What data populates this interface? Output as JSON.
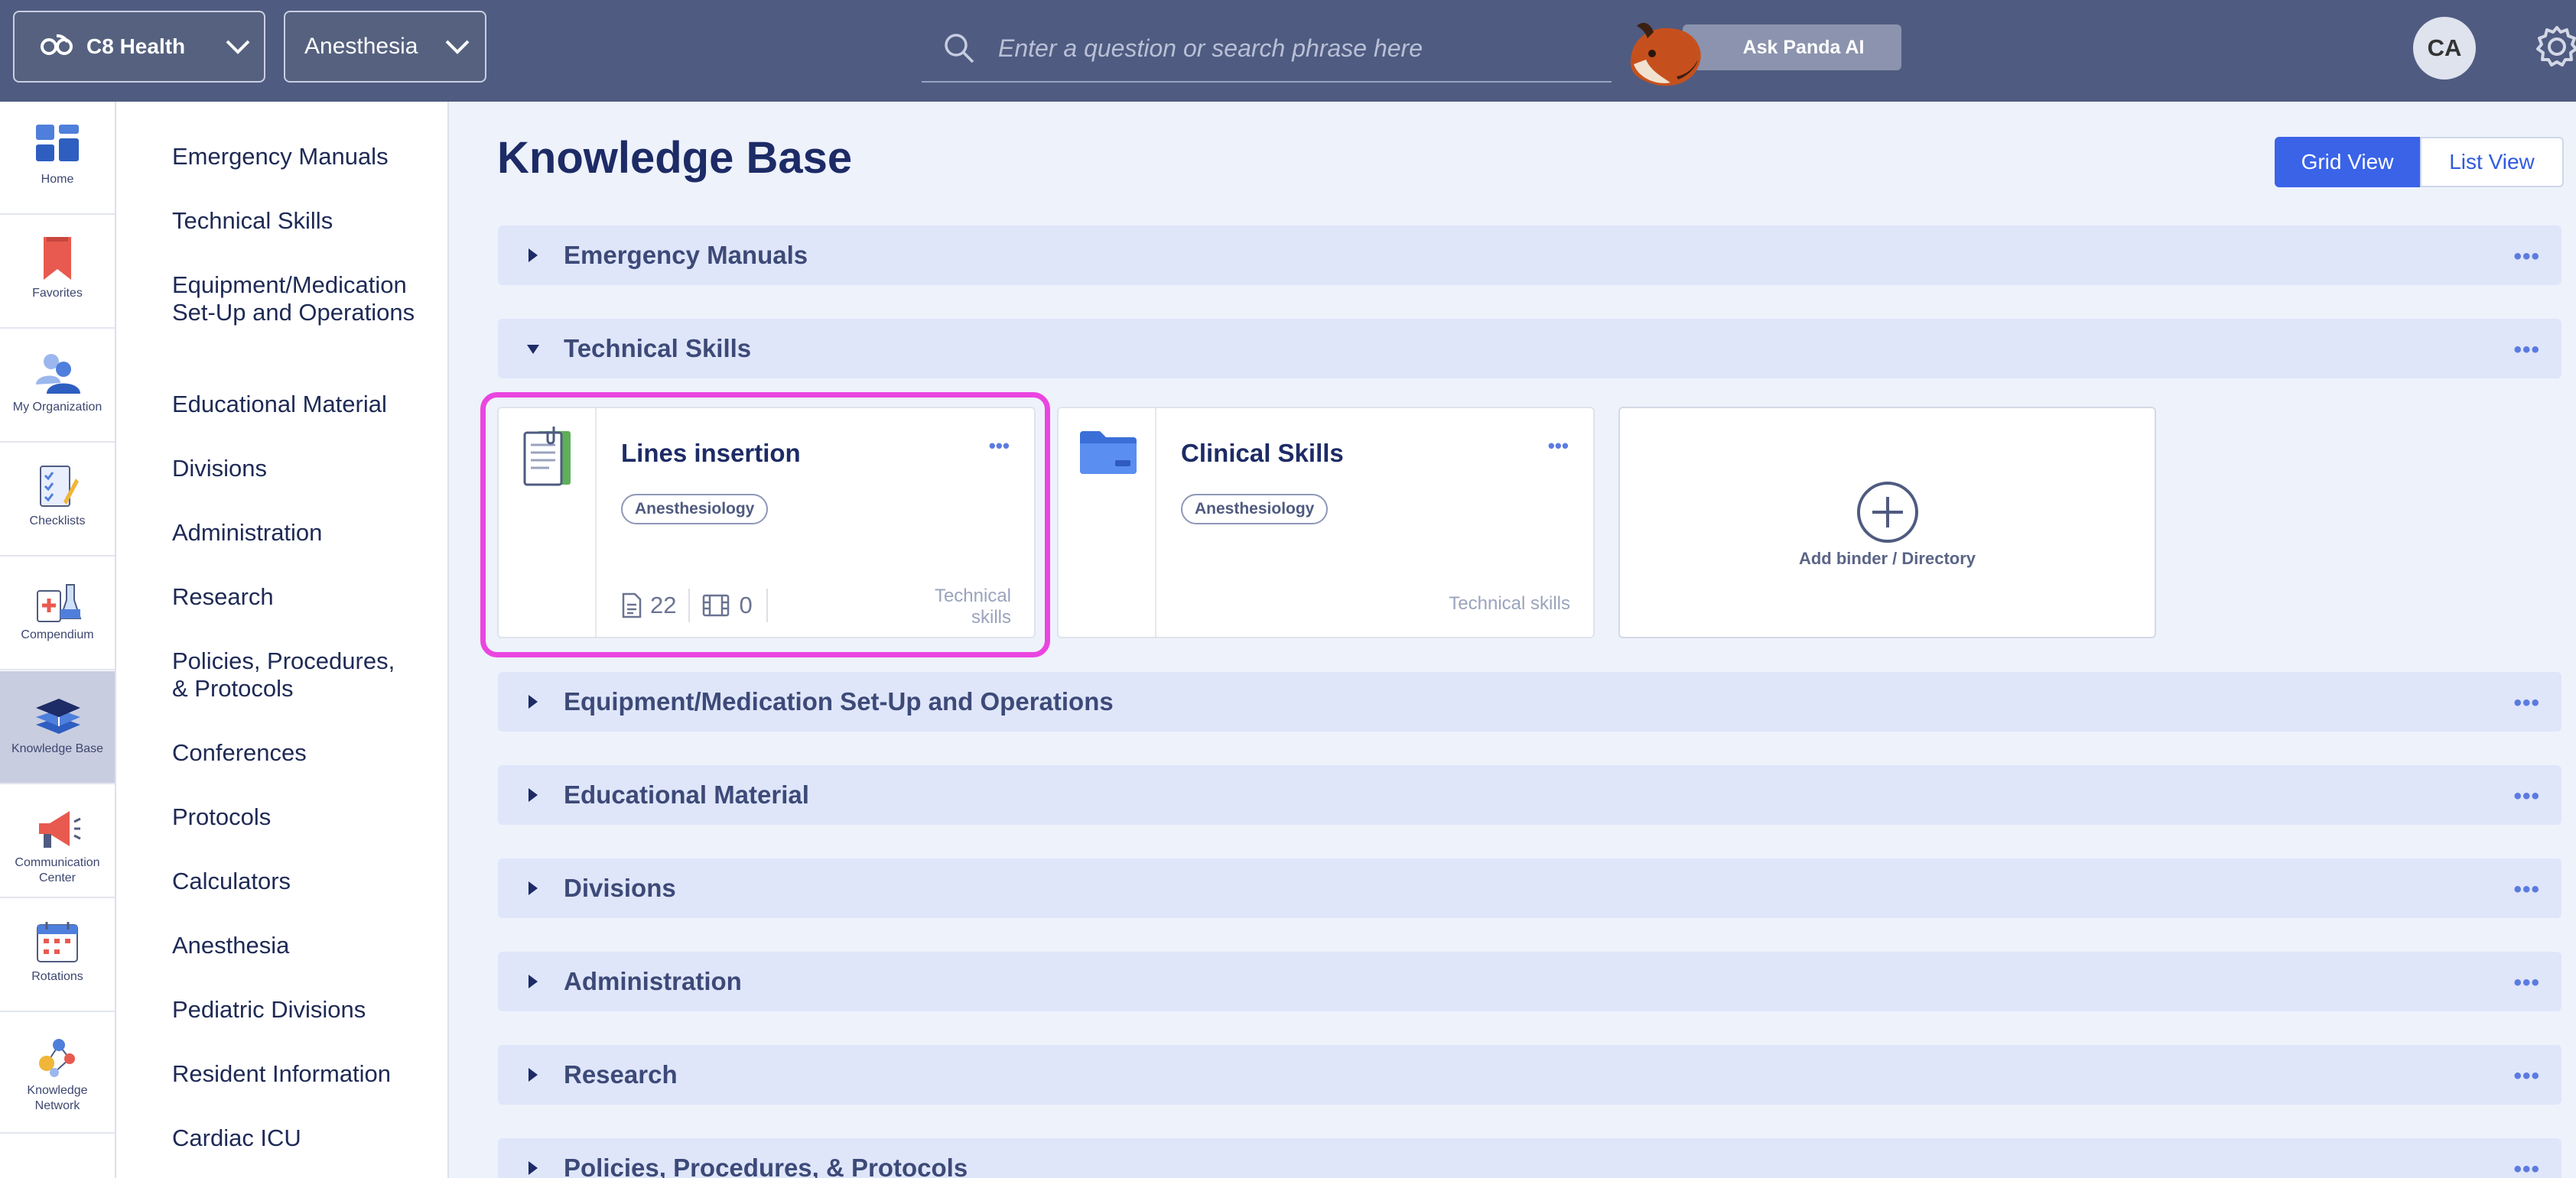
{
  "header": {
    "org_name": "C8 Health",
    "department": "Anesthesia",
    "search_placeholder": "Enter a question or search phrase here",
    "ask_panda_label": "Ask Panda AI",
    "user_initials": "CA"
  },
  "icon_nav": [
    {
      "label": "Home"
    },
    {
      "label": "Favorites"
    },
    {
      "label": "My Organization"
    },
    {
      "label": "Checklists"
    },
    {
      "label": "Compendium"
    },
    {
      "label": "Knowledge Base",
      "active": true
    },
    {
      "label": "Communication Center"
    },
    {
      "label": "Rotations"
    },
    {
      "label": "Knowledge Network"
    }
  ],
  "sidebar": {
    "items": [
      "Emergency Manuals",
      "Technical Skills",
      "Equipment/Medication Set-Up and Operations",
      "Educational Material",
      "Divisions",
      "Administration",
      "Research",
      "Policies, Procedures, & Protocols",
      "Conferences",
      "Protocols",
      "Calculators",
      "Anesthesia",
      "Pediatric Divisions",
      "Resident Information",
      "Cardiac ICU"
    ]
  },
  "main": {
    "title": "Knowledge Base",
    "view_grid": "Grid View",
    "view_list": "List View",
    "active_view": "Grid View",
    "sections": [
      {
        "title": "Emergency Manuals",
        "expanded": false
      },
      {
        "title": "Technical Skills",
        "expanded": true
      },
      {
        "title": "Equipment/Medication Set-Up and Operations",
        "expanded": false
      },
      {
        "title": "Educational Material",
        "expanded": false
      },
      {
        "title": "Divisions",
        "expanded": false
      },
      {
        "title": "Administration",
        "expanded": false
      },
      {
        "title": "Research",
        "expanded": false
      },
      {
        "title": "Policies, Procedures, & Protocols",
        "expanded": false
      }
    ],
    "more_glyph": "•••",
    "cards": [
      {
        "title": "Lines insertion",
        "tag": "Anesthesiology",
        "category": "Technical skills",
        "documents": "22",
        "videos": "0",
        "icon": "binder-icon"
      },
      {
        "title": "Clinical Skills",
        "tag": "Anesthesiology",
        "category": "Technical skills",
        "icon": "folder-icon"
      }
    ],
    "add_label": "Add binder / Directory"
  },
  "colors": {
    "topbar": "#4f5b80",
    "accent": "#3a63e8",
    "highlight": "#ea45e0",
    "section_bg": "#dfe6fa"
  }
}
